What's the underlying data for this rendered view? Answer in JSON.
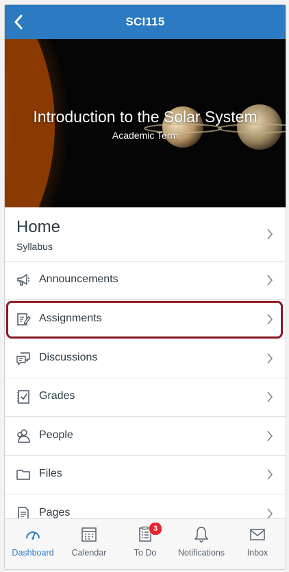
{
  "header": {
    "title": "SCI115",
    "back_icon": "chevron-left-icon"
  },
  "banner": {
    "course_title": "Introduction to the Solar System",
    "term": "Academic Term"
  },
  "home": {
    "title": "Home",
    "subtitle": "Syllabus"
  },
  "nav_items": [
    {
      "label": "Announcements",
      "icon": "megaphone-icon"
    },
    {
      "label": "Assignments",
      "icon": "assignment-icon",
      "highlighted": true
    },
    {
      "label": "Discussions",
      "icon": "discussion-icon"
    },
    {
      "label": "Grades",
      "icon": "grades-icon"
    },
    {
      "label": "People",
      "icon": "people-icon"
    },
    {
      "label": "Files",
      "icon": "folder-icon"
    },
    {
      "label": "Pages",
      "icon": "page-icon"
    }
  ],
  "tabbar": [
    {
      "label": "Dashboard",
      "icon": "dashboard-icon",
      "active": true
    },
    {
      "label": "Calendar",
      "icon": "calendar-icon"
    },
    {
      "label": "To Do",
      "icon": "todo-icon",
      "badge": "3"
    },
    {
      "label": "Notifications",
      "icon": "bell-icon"
    },
    {
      "label": "Inbox",
      "icon": "inbox-icon"
    }
  ],
  "colors": {
    "brand": "#2c7bc2",
    "highlight": "#8b1a28",
    "badge": "#e8242d",
    "text": "#2d3b45"
  }
}
